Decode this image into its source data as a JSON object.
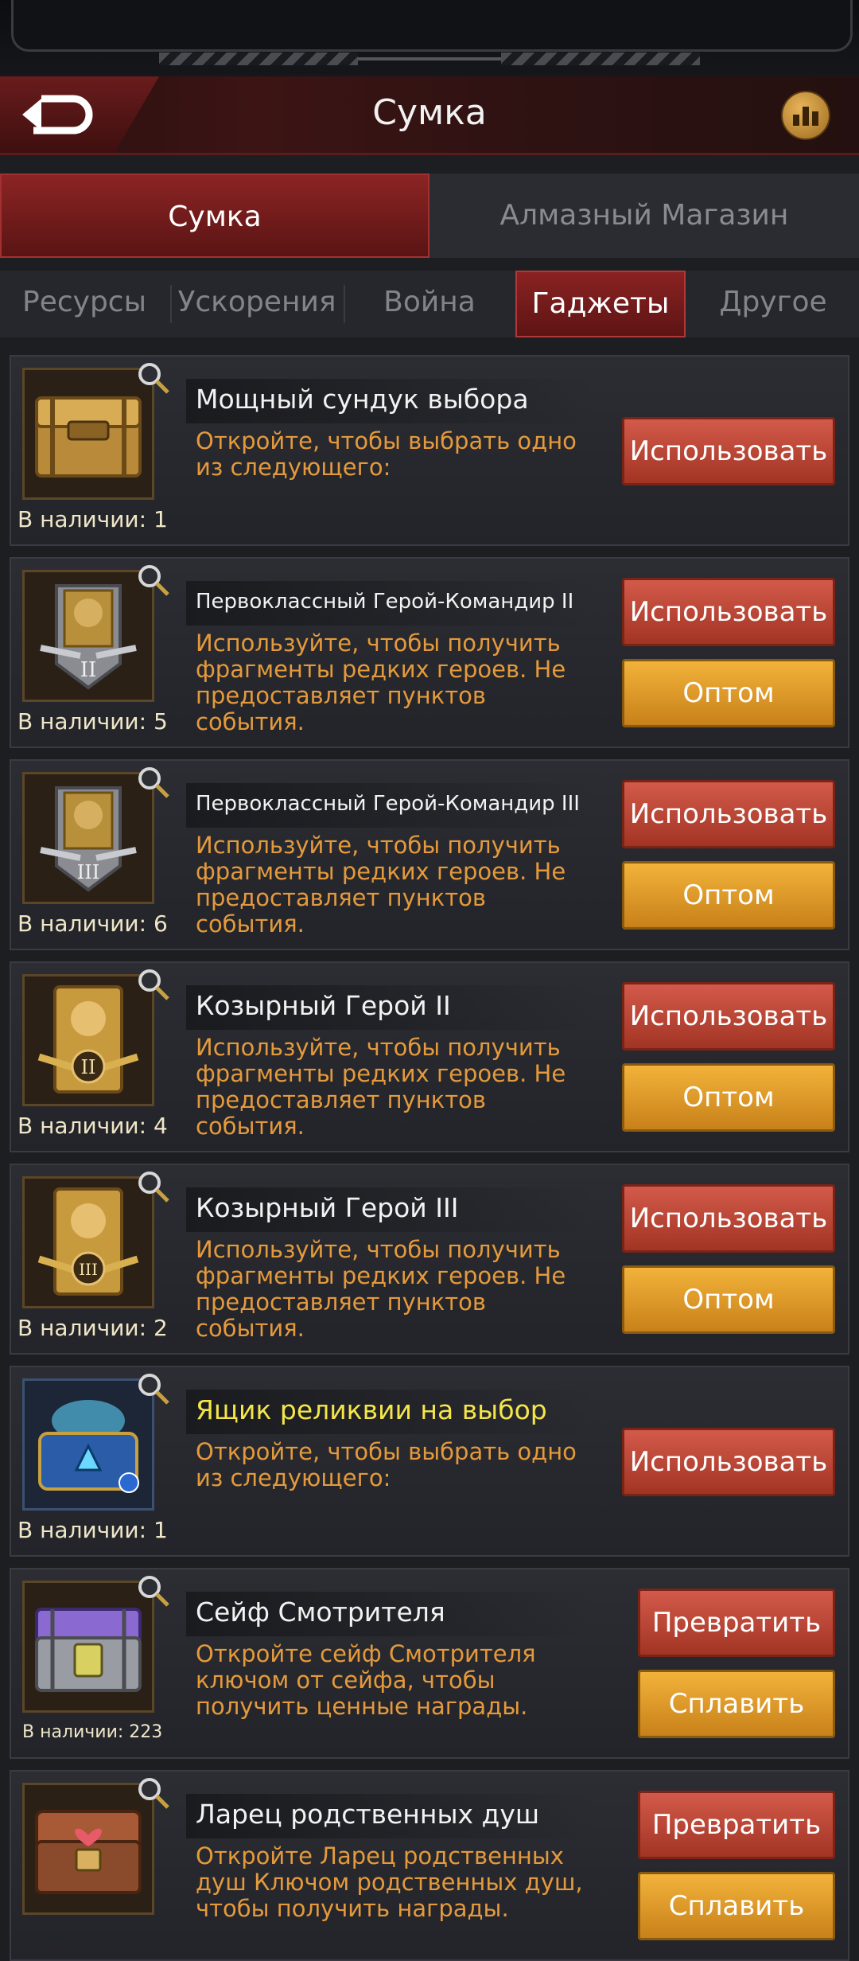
{
  "header": {
    "title": "Сумка"
  },
  "main_tabs": [
    {
      "label": "Сумка",
      "active": true
    },
    {
      "label": "Алмазный Магазин",
      "active": false
    }
  ],
  "sub_tabs": [
    {
      "label": "Ресурсы",
      "active": false
    },
    {
      "label": "Ускорения",
      "active": false
    },
    {
      "label": "Война",
      "active": false
    },
    {
      "label": "Гаджеты",
      "active": true
    },
    {
      "label": "Другое",
      "active": false
    }
  ],
  "items": [
    {
      "name": "Мощный сундук выбора",
      "desc": "Откройте, чтобы выбрать одно из следующего:",
      "qty": "В наличии: 1",
      "icon": "gold-chest-icon",
      "primary": "Использовать"
    },
    {
      "name": "Первоклассный Герой-Командир II",
      "desc": "Используйте, чтобы получить фрагменты редких героев. Не предоставляет пунктов события.",
      "qty": "В наличии: 5",
      "icon": "hero-commander-badge-icon",
      "primary": "Использовать",
      "secondary": "Оптом"
    },
    {
      "name": "Первоклассный Герой-Командир III",
      "desc": "Используйте, чтобы получить фрагменты редких героев. Не предоставляет пунктов события.",
      "qty": "В наличии: 6",
      "icon": "hero-commander-badge-icon",
      "primary": "Использовать",
      "secondary": "Оптом"
    },
    {
      "name": "Козырный Герой II",
      "desc": "Используйте, чтобы получить фрагменты редких героев. Не предоставляет пунктов события.",
      "qty": "В наличии: 4",
      "icon": "trump-hero-card-icon",
      "primary": "Использовать",
      "secondary": "Оптом"
    },
    {
      "name": "Козырный Герой III",
      "desc": "Используйте, чтобы получить фрагменты редких героев. Не предоставляет пунктов события.",
      "qty": "В наличии: 2",
      "icon": "trump-hero-card-icon",
      "primary": "Использовать",
      "secondary": "Оптом"
    },
    {
      "name": "Ящик реликвии на выбор",
      "desc": "Откройте, чтобы выбрать одно из следующего:",
      "qty": "В наличии: 1",
      "icon": "relic-box-icon",
      "primary": "Использовать"
    },
    {
      "name": "Сейф Смотрителя",
      "desc": "Откройте сейф Смотрителя ключом от сейфа, чтобы получить ценные награды.",
      "qty": "В наличии: 223",
      "icon": "keeper-safe-icon",
      "primary": "Превратить",
      "secondary": "Сплавить"
    },
    {
      "name": "Ларец родственных душ",
      "desc": "Откройте Ларец родственных душ Ключом родственных душ, чтобы получить награды.",
      "qty": "",
      "icon": "soulmate-chest-icon",
      "primary": "Превратить",
      "secondary": "Сплавить"
    }
  ],
  "colors": {
    "accent_red": "#8c2424",
    "button_red": "#c04838",
    "button_gold": "#e09a2a",
    "desc_orange": "#e49a3c",
    "highlight_yellow": "#f4e64a"
  }
}
